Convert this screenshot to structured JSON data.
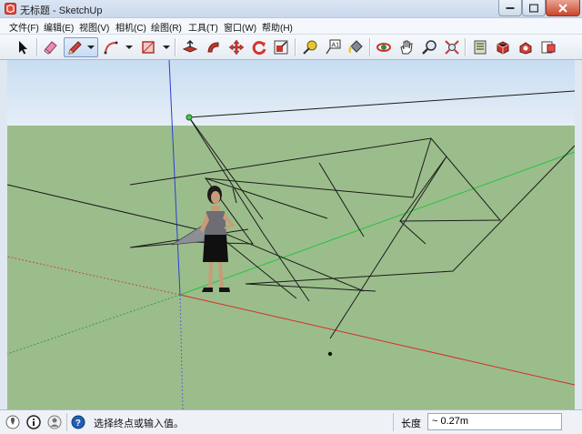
{
  "window": {
    "title": "无标题 - SketchUp"
  },
  "menu": {
    "items": [
      "文件(F)",
      "编辑(E)",
      "视图(V)",
      "相机(C)",
      "绘图(R)",
      "工具(T)",
      "窗口(W)",
      "帮助(H)"
    ]
  },
  "toolbar": {
    "tools": [
      "select-icon",
      "eraser-icon",
      "pencil-line-icon",
      "arc-icon",
      "rectangle-icon",
      "push-pull-icon",
      "follow-me-icon",
      "move-icon",
      "rotate-icon",
      "scale-icon",
      "tape-measure-icon",
      "text-icon",
      "paint-bucket-icon",
      "orbit-icon",
      "pan-icon",
      "zoom-icon",
      "zoom-extents-icon",
      "3d-warehouse-icon",
      "share-model-icon",
      "extension-warehouse-icon",
      "send-to-layout-icon"
    ],
    "active_tool": "pencil-line-icon"
  },
  "colors": {
    "sky": "#d7e7f7",
    "ground": "#9bbd8b",
    "axis_red": "#d62d2d",
    "axis_green": "#23c43f",
    "axis_blue": "#2c3fd1",
    "edge": "#1b1b1b",
    "title_bar": "#cfdcef"
  },
  "status": {
    "message": "选择终点或输入值。",
    "measurement_label": "长度",
    "measurement_value": "~ 0.27m"
  }
}
